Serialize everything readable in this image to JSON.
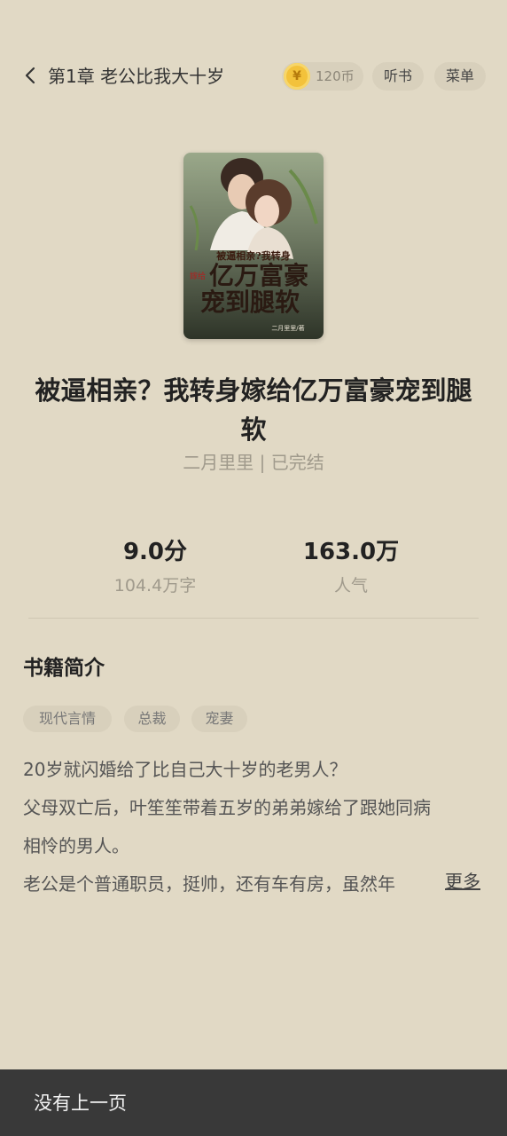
{
  "header": {
    "chapter_title": "第1章 老公比我大十岁",
    "coins": "120币",
    "listen_label": "听书",
    "menu_label": "菜单"
  },
  "book": {
    "cover_title_line1": "被逼相亲?我转身",
    "cover_title_side": "嫁给",
    "cover_title_line2": "亿万富豪",
    "cover_title_line3": "宠到腿软",
    "cover_author": "二月里里/著",
    "title": "被逼相亲？我转身嫁给亿万富豪宠到腿软",
    "author_status": "二月里里 | 已完结"
  },
  "stats": {
    "rating": "9.0分",
    "word_count": "104.4万字",
    "popularity": "163.0万",
    "popularity_label": "人气"
  },
  "intro": {
    "heading": "书籍简介",
    "tags": [
      "现代言情",
      "总裁",
      "宠妻"
    ],
    "lines": [
      "20岁就闪婚给了比自己大十岁的老男人？",
      "父母双亡后，叶笙笙带着五岁的弟弟嫁给了跟她同病",
      "相怜的男人。",
      "老公是个普通职员，挺帅，还有车有房，虽然年"
    ],
    "more_label": "更多"
  },
  "footer": {
    "no_prev_page": "没有上一页"
  },
  "colors": {
    "background": "#e1d9c5",
    "pill": "#d8d0bc",
    "coin": "#f3c23b",
    "bottom_bar": "#393939"
  }
}
